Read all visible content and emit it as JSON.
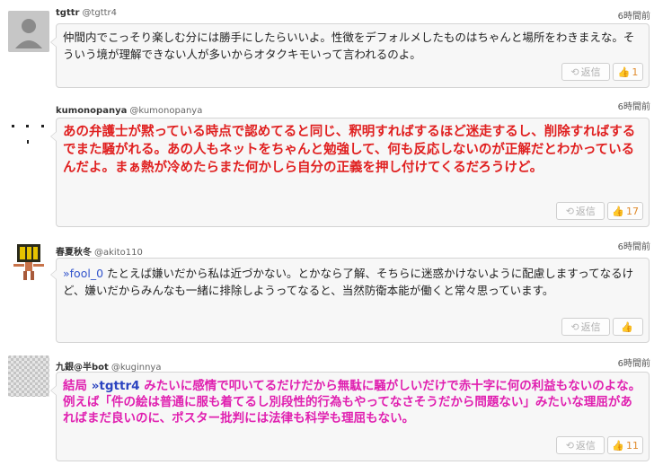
{
  "posts": [
    {
      "name": "tgttr",
      "handle": "@tgttr4",
      "time": "6時間前",
      "text_style": "normal",
      "reply_to": "",
      "text": "仲間内でこっそり楽しむ分には勝手にしたらいいよ。性徴をデフォルメしたものはちゃんと場所をわきまえな。そういう境が理解できない人が多いからオタクキモいって言われるのよ。",
      "reply_label": "返信",
      "likes": "1",
      "avatar": "default-user-avatar"
    },
    {
      "name": "kumonopanya",
      "handle": "@kumonopanya",
      "time": "6時間前",
      "text_style": "red",
      "reply_to": "",
      "text": "あの弁護士が黙っている時点で認めてると同じ、釈明すればするほど迷走するし、削除すればするでまた騒がれる。あの人もネットをちゃんと勉強して、何も反応しないのが正解だとわかっているんだよ。まぁ熱が冷めたらまた何かしら自分の正義を押し付けてくるだろうけど。",
      "reply_label": "返信",
      "likes": "17",
      "avatar": "dots-avatar"
    },
    {
      "name": "春夏秋冬",
      "handle": "@akito110",
      "time": "6時間前",
      "text_style": "normal",
      "reply_to": "»fool_0",
      "text": "たとえば嫌いだから私は近づかない。とかなら了解、そちらに迷惑かけないように配慮しますってなるけど、嫌いだからみんなも一緒に排除しようってなると、当然防衛本能が働くと常々思っています。",
      "reply_label": "返信",
      "likes": "",
      "avatar": "character-avatar"
    },
    {
      "name": "九銀@半bot",
      "handle": "@kuginnya",
      "time": "6時間前",
      "text_style": "magenta",
      "reply_prefix": "結局",
      "reply_to": "»tgttr4",
      "text": "みたいに感情で叩いてるだけだから無駄に騒がしいだけで赤十字に何の利益もないのよな。例えば「件の絵は普通に服も着てるし別段性的行為もやってなさそうだから問題ない」みたいな理屈があればまだ良いのに、ポスター批判には法律も科学も理屈もない。",
      "reply_label": "返信",
      "likes": "11",
      "avatar": "checker-avatar"
    }
  ]
}
